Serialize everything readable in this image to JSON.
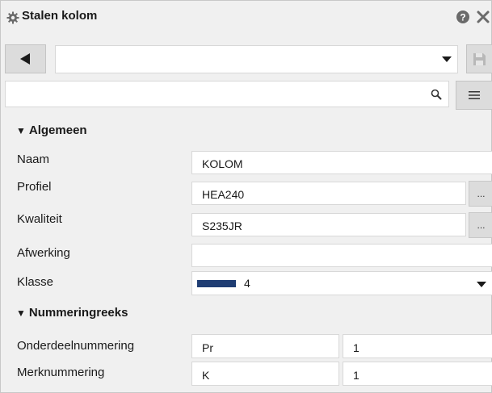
{
  "window": {
    "title": "Stalen kolom",
    "icons": {
      "title": "gear-icon",
      "help": "help-icon",
      "close": "close-icon"
    }
  },
  "toolbar": {
    "preset_value": "",
    "icons": {
      "back": "triangle-left-icon",
      "dropdown": "chevron-down-icon",
      "save": "save-icon"
    }
  },
  "search": {
    "value": "",
    "icons": {
      "search": "search-icon",
      "menu": "hamburger-menu-icon"
    }
  },
  "sections": {
    "general": {
      "title": "Algemeen",
      "fields": {
        "name": {
          "label": "Naam",
          "value": "KOLOM"
        },
        "profile": {
          "label": "Profiel",
          "value": "HEA240",
          "browse_label": "..."
        },
        "material": {
          "label": "Kwaliteit",
          "value": "S235JR",
          "browse_label": "..."
        },
        "finish": {
          "label": "Afwerking",
          "value": ""
        },
        "class": {
          "label": "Klasse",
          "value": "4",
          "color": "#1f3d73"
        }
      }
    },
    "numbering": {
      "title": "Nummeringreeks",
      "part": {
        "label": "Onderdeelnummering",
        "prefix": "Pr",
        "start": "1"
      },
      "assembly": {
        "label": "Merknummering",
        "prefix": "K",
        "start": "1"
      }
    }
  },
  "colors": {
    "background": "#f0f0f0",
    "button": "#dcdcdc",
    "field": "#ffffff",
    "class_swatch": "#1f3d73"
  }
}
